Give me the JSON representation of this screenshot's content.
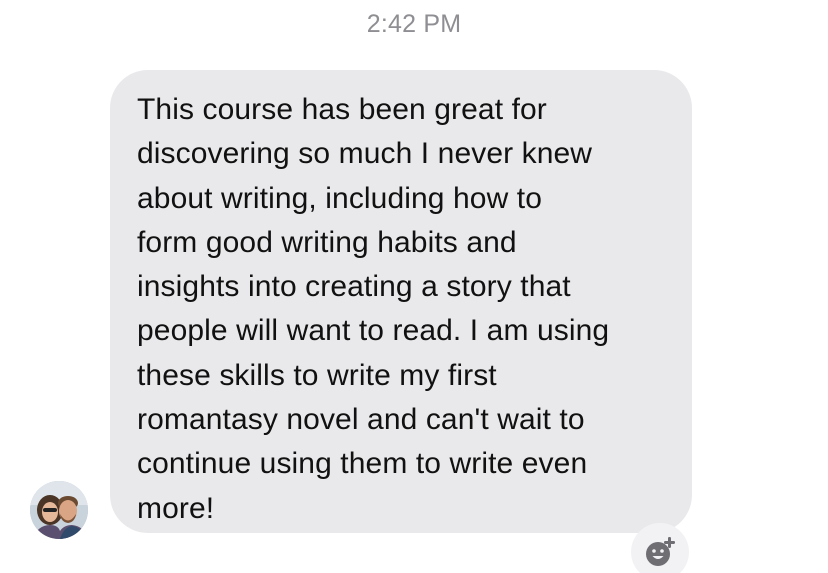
{
  "conversation": {
    "timestamp": "2:42 PM",
    "message": {
      "text": "This course has been great for\ndiscovering so much I never knew\nabout writing, including how to\nform good writing habits and\ninsights into creating a story that\npeople will want to read. I am using\nthese skills to write my first\nromantasy novel and can't wait to\ncontinue using them to write even\nmore!"
    },
    "sender": {
      "avatar_icon": "user-avatar-photo"
    },
    "reaction": {
      "icon": "add-reaction-icon"
    }
  },
  "colors": {
    "bubble": "#e9e9eb",
    "timestamp": "#8e8e93",
    "text": "#111111",
    "reaction_bg": "#f2f2f5",
    "reaction_icon": "#6e6e73"
  }
}
